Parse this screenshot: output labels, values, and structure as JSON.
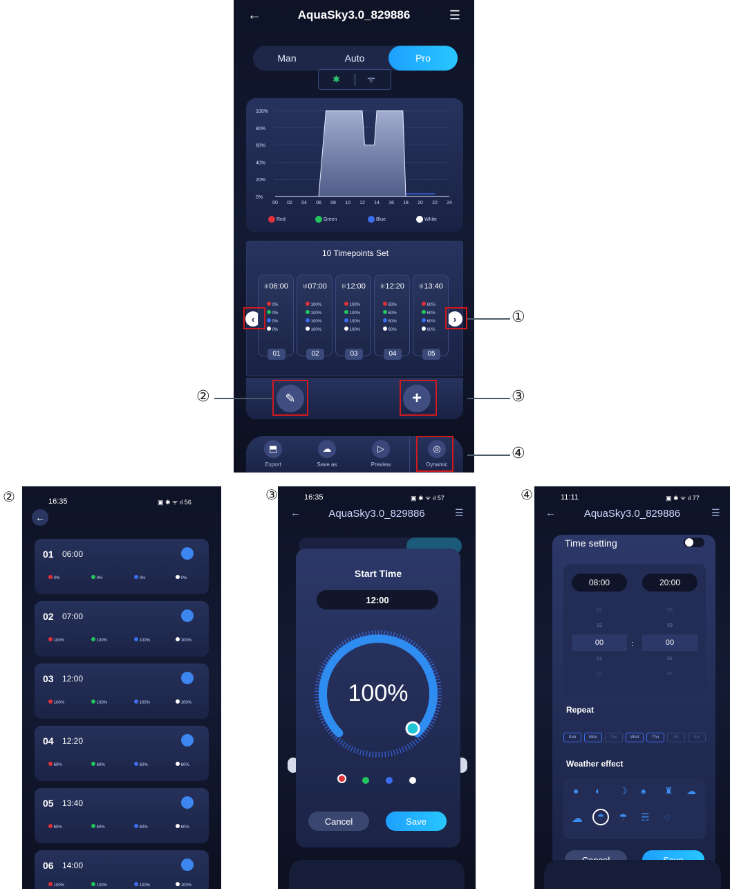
{
  "main": {
    "device_name": "AquaSky3.0_829886",
    "menu_icon": "menu-icon",
    "back_icon": "back-arrow-icon",
    "modes": [
      "Man",
      "Auto",
      "Pro"
    ],
    "active_mode": "Pro",
    "connectivity": {
      "bluetooth_icon": "bluetooth-icon",
      "wifi_icon": "wifi-icon"
    },
    "timepoints_title": "10 Timepoints Set",
    "legend": [
      {
        "label": "Red",
        "color": "#e0303a"
      },
      {
        "label": "Green",
        "color": "#22c55e"
      },
      {
        "label": "Blue",
        "color": "#3b6ff0"
      },
      {
        "label": "White",
        "color": "#ffffff"
      }
    ],
    "timepoints": [
      {
        "index": "01",
        "time": "06:00",
        "values": [
          "0%",
          "0%",
          "0%",
          "0%"
        ]
      },
      {
        "index": "02",
        "time": "07:00",
        "values": [
          "100%",
          "100%",
          "100%",
          "100%"
        ]
      },
      {
        "index": "03",
        "time": "12:00",
        "values": [
          "100%",
          "100%",
          "100%",
          "100%"
        ]
      },
      {
        "index": "04",
        "time": "12:20",
        "values": [
          "60%",
          "60%",
          "60%",
          "60%"
        ]
      },
      {
        "index": "05",
        "time": "13:40",
        "values": [
          "60%",
          "60%",
          "60%",
          "60%"
        ]
      }
    ],
    "bottom_tabs": [
      "Export",
      "Save as",
      "Preview",
      "Dynamic"
    ]
  },
  "chart_data": {
    "type": "area",
    "x_ticks": [
      "00",
      "02",
      "04",
      "06",
      "08",
      "10",
      "12",
      "14",
      "16",
      "18",
      "20",
      "22",
      "24"
    ],
    "y_ticks": [
      "100%",
      "80%",
      "60%",
      "40%",
      "20%",
      "0%"
    ],
    "ylim": [
      0,
      100
    ],
    "xlim": [
      0,
      24
    ],
    "series": [
      {
        "name": "White",
        "x": [
          0,
          6,
          7,
          12,
          12.33,
          13.67,
          14,
          17.6,
          18,
          24
        ],
        "y": [
          0,
          0,
          100,
          100,
          60,
          60,
          100,
          100,
          0,
          0
        ]
      },
      {
        "name": "Blue",
        "x": [
          18,
          22
        ],
        "y": [
          3,
          3
        ]
      }
    ]
  },
  "callouts": [
    "①",
    "②",
    "③",
    "④"
  ],
  "panel2": {
    "label": "②",
    "status_time": "16:35",
    "status_icons": "▣ ✱ ᯤ ıl 56",
    "rows": [
      {
        "index": "01",
        "time": "06:00",
        "values": [
          "0%",
          "0%",
          "0%",
          "0%"
        ]
      },
      {
        "index": "02",
        "time": "07:00",
        "values": [
          "100%",
          "100%",
          "100%",
          "100%"
        ]
      },
      {
        "index": "03",
        "time": "12:00",
        "values": [
          "100%",
          "100%",
          "100%",
          "100%"
        ]
      },
      {
        "index": "04",
        "time": "12:20",
        "values": [
          "60%",
          "60%",
          "60%",
          "60%"
        ]
      },
      {
        "index": "05",
        "time": "13:40",
        "values": [
          "60%",
          "60%",
          "60%",
          "60%"
        ]
      },
      {
        "index": "06",
        "time": "14:00",
        "values": [
          "100%",
          "100%",
          "100%",
          "100%"
        ]
      }
    ]
  },
  "panel3": {
    "label": "③",
    "status_time": "16:35",
    "status_icons": "▣ ✱ ᯤ ıl 57",
    "device_name": "AquaSky3.0_829886",
    "dialog_title": "Start Time",
    "time_value": "12:00",
    "dial_value": "100%",
    "dial_fraction": 1.0,
    "cancel_label": "Cancel",
    "save_label": "Save"
  },
  "panel4": {
    "label": "④",
    "status_time": "11:11",
    "status_icons": "▣ ✱ ᯤ ıl 77",
    "device_name": "AquaSky3.0_829886",
    "time_setting_label": "Time setting",
    "start_time": "08:00",
    "end_time": "20:00",
    "picker_hours": [
      "22",
      "23",
      "00",
      "01",
      "02"
    ],
    "picker_minutes": [
      "58",
      "59",
      "00",
      "01",
      "02"
    ],
    "picker_separator": ":",
    "repeat_label": "Repeat",
    "days": [
      "Sun",
      "Mon",
      "Tue",
      "Wed",
      "Thu",
      "Fri",
      "Sat"
    ],
    "weather_label": "Weather effect",
    "cancel_label": "Cancel",
    "save_label": "Save"
  }
}
